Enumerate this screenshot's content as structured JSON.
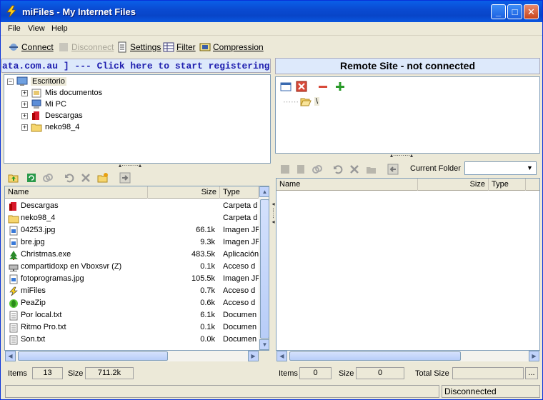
{
  "window": {
    "title": "miFiles - My Internet Files"
  },
  "menu": [
    "File",
    "View",
    "Help"
  ],
  "toolbar": {
    "connect": "Connect",
    "disconnect": "Disconnect",
    "settings": "Settings",
    "filter": "Filter",
    "compression": "Compression"
  },
  "left": {
    "banner": "ata.com.au ] --- Click here to start registering",
    "tree": [
      {
        "label": "Escritorio",
        "icon": "desktop-icon"
      },
      {
        "label": "Mis documentos",
        "icon": "my-documents-icon"
      },
      {
        "label": "Mi PC",
        "icon": "my-computer-icon"
      },
      {
        "label": "Descargas",
        "icon": "downloads-icon"
      },
      {
        "label": "neko98_4",
        "icon": "folder-icon"
      }
    ],
    "columns": {
      "name": "Name",
      "size": "Size",
      "type": "Type"
    },
    "files": [
      {
        "name": "Descargas",
        "size": "",
        "type": "Carpeta d",
        "icon": "downloads-icon"
      },
      {
        "name": "neko98_4",
        "size": "",
        "type": "Carpeta d",
        "icon": "folder-icon"
      },
      {
        "name": "04253.jpg",
        "size": "66.1k",
        "type": "Imagen JF",
        "icon": "image-file-icon"
      },
      {
        "name": "bre.jpg",
        "size": "9.3k",
        "type": "Imagen JF",
        "icon": "image-file-icon"
      },
      {
        "name": "Christmas.exe",
        "size": "483.5k",
        "type": "Aplicación",
        "icon": "tree-app-icon"
      },
      {
        "name": "compartidoxp en Vboxsvr (Z)",
        "size": "0.1k",
        "type": "Acceso d",
        "icon": "network-drive-icon"
      },
      {
        "name": "fotoprogramas.jpg",
        "size": "105.5k",
        "type": "Imagen JF",
        "icon": "image-file-icon"
      },
      {
        "name": "miFiles",
        "size": "0.7k",
        "type": "Acceso d",
        "icon": "mifiles-shortcut-icon"
      },
      {
        "name": "PeaZip",
        "size": "0.6k",
        "type": "Acceso d",
        "icon": "peazip-icon"
      },
      {
        "name": "Por local.txt",
        "size": "6.1k",
        "type": "Documen",
        "icon": "text-file-icon"
      },
      {
        "name": "Ritmo Pro.txt",
        "size": "0.1k",
        "type": "Documen",
        "icon": "text-file-icon"
      },
      {
        "name": "Son.txt",
        "size": "0.0k",
        "type": "Documen",
        "icon": "text-file-icon"
      }
    ],
    "status": {
      "items_label": "Items",
      "items_value": "13",
      "size_label": "Size",
      "size_value": "711.2k"
    }
  },
  "right": {
    "title": "Remote Site - not connected",
    "root": "\\",
    "current_folder_label": "Current Folder",
    "columns": {
      "name": "Name",
      "size": "Size",
      "type": "Type"
    },
    "status": {
      "items_label": "Items",
      "items_value": "0",
      "size_label": "Size",
      "size_value": "0",
      "total_label": "Total Size",
      "total_value": "",
      "more": "..."
    }
  },
  "statusbar": {
    "text": "",
    "connection": "Disconnected"
  },
  "colors": {
    "titlebar": "#0a4bd2",
    "banner_bg": "#dde9fb",
    "banner_text": "#1f1faf"
  }
}
